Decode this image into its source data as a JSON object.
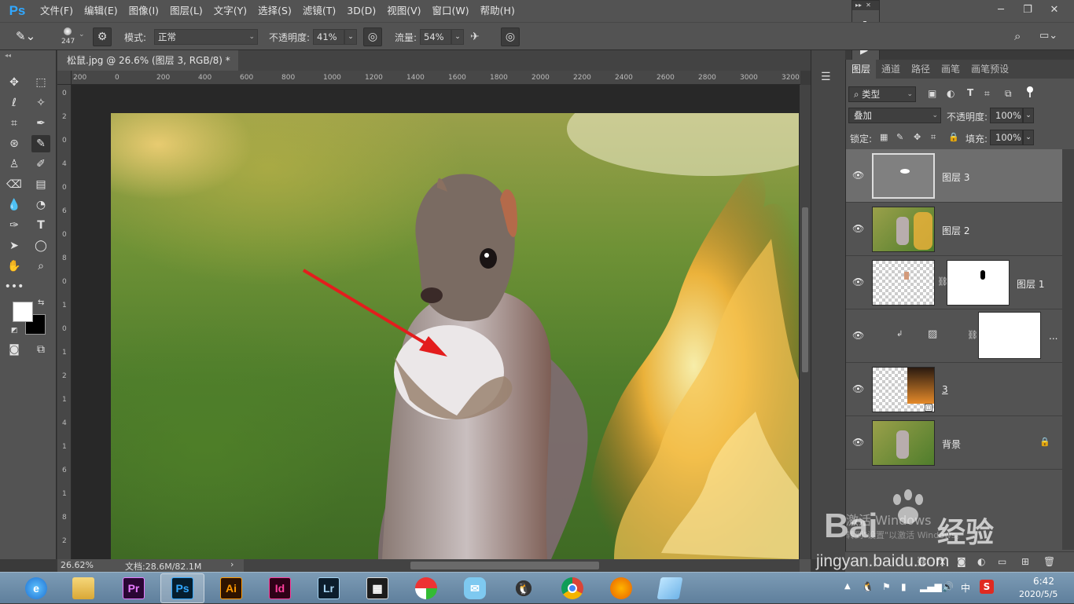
{
  "menubar": {
    "logo": "Ps",
    "items": [
      "文件(F)",
      "编辑(E)",
      "图像(I)",
      "图层(L)",
      "文字(Y)",
      "选择(S)",
      "滤镜(T)",
      "3D(D)",
      "视图(V)",
      "窗口(W)",
      "帮助(H)"
    ]
  },
  "options": {
    "brush_size": "247",
    "mode_label": "模式:",
    "mode_value": "正常",
    "opacity_label": "不透明度:",
    "opacity_value": "41%",
    "flow_label": "流量:",
    "flow_value": "54%"
  },
  "document": {
    "tab_title": "松鼠.jpg @ 26.6% (图层 3, RGB/8) *",
    "zoom": "26.62%",
    "doc_info": "文档:28.6M/82.1M",
    "ruler_top": [
      "200",
      "0",
      "200",
      "400",
      "600",
      "800",
      "1000",
      "1200",
      "1400",
      "1600",
      "1800",
      "2000",
      "2200",
      "2400",
      "2600",
      "2800",
      "3000",
      "3200"
    ],
    "ruler_left": [
      "0",
      "2",
      "0",
      "4",
      "0",
      "6",
      "0",
      "8",
      "0",
      "1",
      "0",
      "1",
      "2",
      "1",
      "4",
      "1",
      "6",
      "1",
      "8",
      "2"
    ]
  },
  "panel": {
    "tabs": [
      "图层",
      "通道",
      "路径",
      "画笔",
      "画笔预设"
    ],
    "active_tab": "图层",
    "filter_kind": "类型",
    "blend_mode": "叠加",
    "opacity_label": "不透明度:",
    "opacity_value": "100%",
    "lock_label": "锁定:",
    "fill_label": "填充:",
    "fill_value": "100%",
    "layers": [
      {
        "name": "图层 3",
        "selected": true
      },
      {
        "name": "图层 2",
        "selected": false
      },
      {
        "name": "图层 1",
        "selected": false
      },
      {
        "name": "...",
        "selected": false
      },
      {
        "name": "3",
        "selected": false
      },
      {
        "name": "背景",
        "selected": false
      }
    ]
  },
  "watermark": {
    "activate_text": "激活 Windows",
    "activate_sub": "转到\"设置\"以激活 Windows。",
    "brand_a": "Bai",
    "brand_b": "经验",
    "site": "jingyan.baidu.com"
  },
  "taskbar": {
    "apps": [
      "IE",
      "Explorer",
      "Pr",
      "Ps",
      "Ai",
      "Id",
      "Lr",
      "Video",
      "Palette",
      "Mail",
      "QQ",
      "Chrome",
      "Firefox",
      "Notes"
    ],
    "time": "6:42",
    "date": "2020/5/5",
    "ime": "中"
  },
  "colors": {
    "ps_blue": "#31a8ff",
    "ui_dark": "#535353",
    "arrow_red": "#e31d1d"
  }
}
